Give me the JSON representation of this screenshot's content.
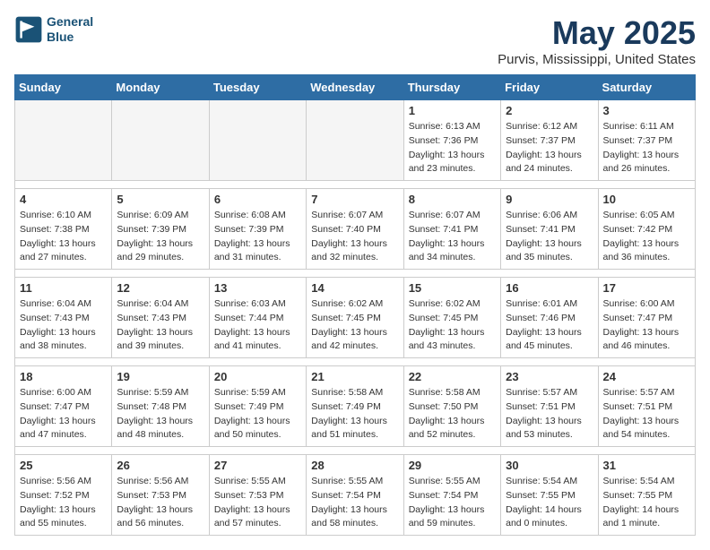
{
  "header": {
    "logo_line1": "General",
    "logo_line2": "Blue",
    "title": "May 2025",
    "subtitle": "Purvis, Mississippi, United States"
  },
  "weekdays": [
    "Sunday",
    "Monday",
    "Tuesday",
    "Wednesday",
    "Thursday",
    "Friday",
    "Saturday"
  ],
  "weeks": [
    [
      {
        "day": "",
        "empty": true
      },
      {
        "day": "",
        "empty": true
      },
      {
        "day": "",
        "empty": true
      },
      {
        "day": "",
        "empty": true
      },
      {
        "day": "1",
        "sunrise": "6:13 AM",
        "sunset": "7:36 PM",
        "daylight": "13 hours and 23 minutes."
      },
      {
        "day": "2",
        "sunrise": "6:12 AM",
        "sunset": "7:37 PM",
        "daylight": "13 hours and 24 minutes."
      },
      {
        "day": "3",
        "sunrise": "6:11 AM",
        "sunset": "7:37 PM",
        "daylight": "13 hours and 26 minutes."
      }
    ],
    [
      {
        "day": "4",
        "sunrise": "6:10 AM",
        "sunset": "7:38 PM",
        "daylight": "13 hours and 27 minutes."
      },
      {
        "day": "5",
        "sunrise": "6:09 AM",
        "sunset": "7:39 PM",
        "daylight": "13 hours and 29 minutes."
      },
      {
        "day": "6",
        "sunrise": "6:08 AM",
        "sunset": "7:39 PM",
        "daylight": "13 hours and 31 minutes."
      },
      {
        "day": "7",
        "sunrise": "6:07 AM",
        "sunset": "7:40 PM",
        "daylight": "13 hours and 32 minutes."
      },
      {
        "day": "8",
        "sunrise": "6:07 AM",
        "sunset": "7:41 PM",
        "daylight": "13 hours and 34 minutes."
      },
      {
        "day": "9",
        "sunrise": "6:06 AM",
        "sunset": "7:41 PM",
        "daylight": "13 hours and 35 minutes."
      },
      {
        "day": "10",
        "sunrise": "6:05 AM",
        "sunset": "7:42 PM",
        "daylight": "13 hours and 36 minutes."
      }
    ],
    [
      {
        "day": "11",
        "sunrise": "6:04 AM",
        "sunset": "7:43 PM",
        "daylight": "13 hours and 38 minutes."
      },
      {
        "day": "12",
        "sunrise": "6:04 AM",
        "sunset": "7:43 PM",
        "daylight": "13 hours and 39 minutes."
      },
      {
        "day": "13",
        "sunrise": "6:03 AM",
        "sunset": "7:44 PM",
        "daylight": "13 hours and 41 minutes."
      },
      {
        "day": "14",
        "sunrise": "6:02 AM",
        "sunset": "7:45 PM",
        "daylight": "13 hours and 42 minutes."
      },
      {
        "day": "15",
        "sunrise": "6:02 AM",
        "sunset": "7:45 PM",
        "daylight": "13 hours and 43 minutes."
      },
      {
        "day": "16",
        "sunrise": "6:01 AM",
        "sunset": "7:46 PM",
        "daylight": "13 hours and 45 minutes."
      },
      {
        "day": "17",
        "sunrise": "6:00 AM",
        "sunset": "7:47 PM",
        "daylight": "13 hours and 46 minutes."
      }
    ],
    [
      {
        "day": "18",
        "sunrise": "6:00 AM",
        "sunset": "7:47 PM",
        "daylight": "13 hours and 47 minutes."
      },
      {
        "day": "19",
        "sunrise": "5:59 AM",
        "sunset": "7:48 PM",
        "daylight": "13 hours and 48 minutes."
      },
      {
        "day": "20",
        "sunrise": "5:59 AM",
        "sunset": "7:49 PM",
        "daylight": "13 hours and 50 minutes."
      },
      {
        "day": "21",
        "sunrise": "5:58 AM",
        "sunset": "7:49 PM",
        "daylight": "13 hours and 51 minutes."
      },
      {
        "day": "22",
        "sunrise": "5:58 AM",
        "sunset": "7:50 PM",
        "daylight": "13 hours and 52 minutes."
      },
      {
        "day": "23",
        "sunrise": "5:57 AM",
        "sunset": "7:51 PM",
        "daylight": "13 hours and 53 minutes."
      },
      {
        "day": "24",
        "sunrise": "5:57 AM",
        "sunset": "7:51 PM",
        "daylight": "13 hours and 54 minutes."
      }
    ],
    [
      {
        "day": "25",
        "sunrise": "5:56 AM",
        "sunset": "7:52 PM",
        "daylight": "13 hours and 55 minutes."
      },
      {
        "day": "26",
        "sunrise": "5:56 AM",
        "sunset": "7:53 PM",
        "daylight": "13 hours and 56 minutes."
      },
      {
        "day": "27",
        "sunrise": "5:55 AM",
        "sunset": "7:53 PM",
        "daylight": "13 hours and 57 minutes."
      },
      {
        "day": "28",
        "sunrise": "5:55 AM",
        "sunset": "7:54 PM",
        "daylight": "13 hours and 58 minutes."
      },
      {
        "day": "29",
        "sunrise": "5:55 AM",
        "sunset": "7:54 PM",
        "daylight": "13 hours and 59 minutes."
      },
      {
        "day": "30",
        "sunrise": "5:54 AM",
        "sunset": "7:55 PM",
        "daylight": "14 hours and 0 minutes."
      },
      {
        "day": "31",
        "sunrise": "5:54 AM",
        "sunset": "7:55 PM",
        "daylight": "14 hours and 1 minute."
      }
    ]
  ]
}
